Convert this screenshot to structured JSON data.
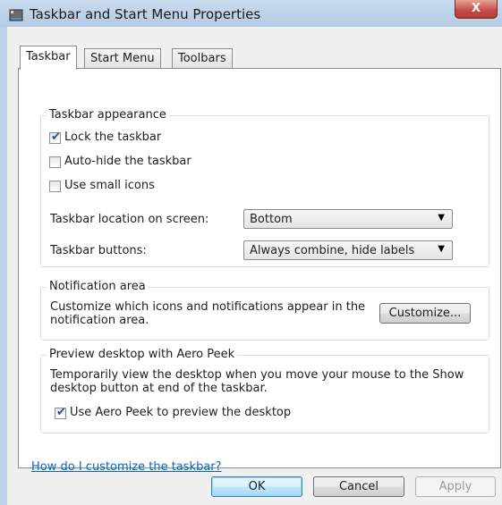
{
  "window": {
    "title": "Taskbar and Start Menu Properties",
    "close_label": "X"
  },
  "tabs": [
    {
      "label": "Taskbar",
      "active": true
    },
    {
      "label": "Start Menu",
      "active": false
    },
    {
      "label": "Toolbars",
      "active": false
    }
  ],
  "appearance": {
    "legend": "Taskbar appearance",
    "lock": {
      "label": "Lock the taskbar",
      "checked": true
    },
    "autohide": {
      "label": "Auto-hide the taskbar",
      "checked": false
    },
    "small_icons": {
      "label": "Use small icons",
      "checked": false
    },
    "location_label": "Taskbar location on screen:",
    "location_value": "Bottom",
    "buttons_label": "Taskbar buttons:",
    "buttons_value": "Always combine, hide labels"
  },
  "notification": {
    "legend": "Notification area",
    "text": "Customize which icons and notifications appear in the notification area.",
    "customize_label": "Customize..."
  },
  "peek": {
    "legend": "Preview desktop with Aero Peek",
    "text": "Temporarily view the desktop when you move your mouse to the Show desktop button at end of the taskbar.",
    "use_peek": {
      "label": "Use Aero Peek to preview the desktop",
      "checked": true
    }
  },
  "help_link": "How do I customize the taskbar?",
  "buttons": {
    "ok": "OK",
    "cancel": "Cancel",
    "apply": "Apply"
  },
  "colors": {
    "accent": "#0066cc",
    "close": "#c75050"
  }
}
